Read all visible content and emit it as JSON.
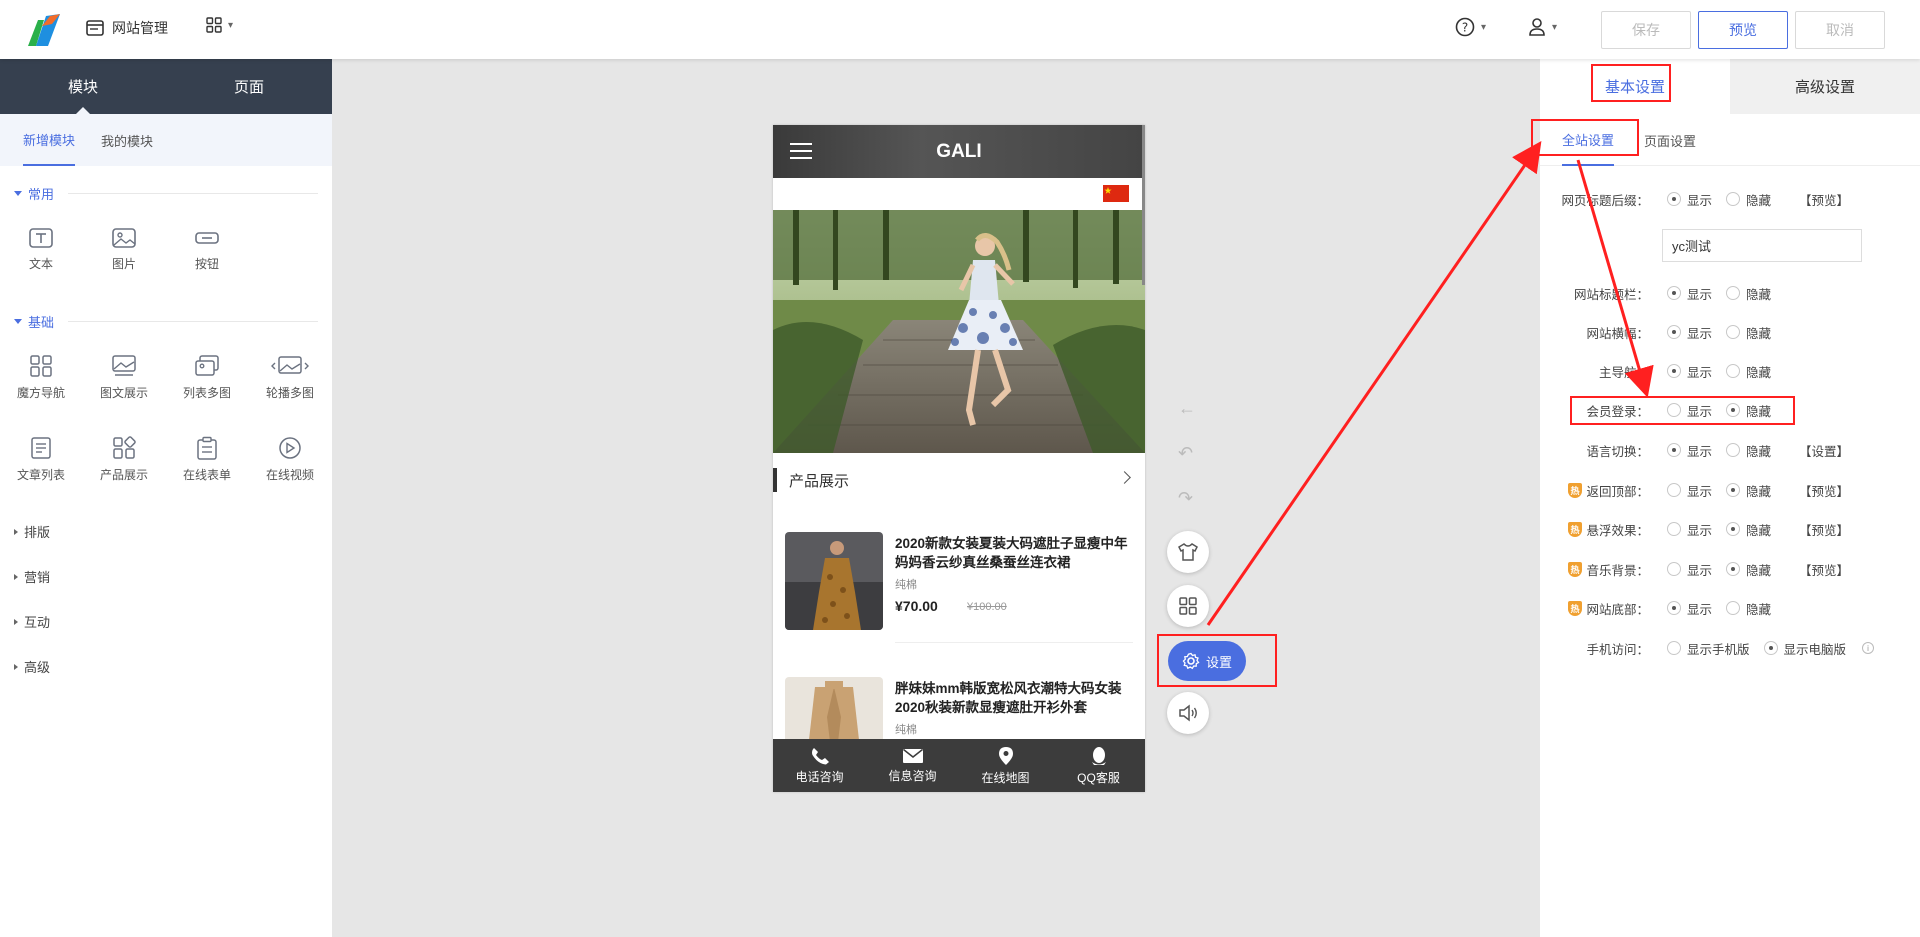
{
  "topbar": {
    "site_manage": "网站管理",
    "save": "保存",
    "preview": "预览",
    "cancel": "取消"
  },
  "left": {
    "tabs": [
      "模块",
      "页面"
    ],
    "subtabs": [
      "新增模块",
      "我的模块"
    ],
    "categories": {
      "common": "常用",
      "basic": "基础",
      "layout": "排版",
      "marketing": "营销",
      "interact": "互动",
      "advanced": "高级"
    },
    "common_modules": [
      "文本",
      "图片",
      "按钮"
    ],
    "basic_modules": [
      "魔方导航",
      "图文展示",
      "列表多图",
      "轮播多图",
      "文章列表",
      "产品展示",
      "在线表单",
      "在线视频"
    ]
  },
  "phone": {
    "title": "GALI",
    "section": "产品展示",
    "products": [
      {
        "name": "2020新款女装夏装大码遮肚子显瘦中年妈妈香云纱真丝桑蚕丝连衣裙",
        "material": "纯棉",
        "price": "¥70.00",
        "old_price": "¥100.00"
      },
      {
        "name": "胖妹妹mm韩版宽松风衣潮特大码女装2020秋装新款显瘦遮肚开衫外套",
        "material": "纯棉"
      }
    ],
    "footer": [
      "电话咨询",
      "信息咨询",
      "在线地图",
      "QQ客服"
    ]
  },
  "tools": {
    "settings": "设置"
  },
  "right": {
    "tabs": [
      "基本设置",
      "高级设置"
    ],
    "subtabs": [
      "全站设置",
      "页面设置"
    ],
    "input_value": "yc测试",
    "hot_badge": "热",
    "rows": [
      {
        "label": "网页标题后缀：",
        "opt1": "显示",
        "opt2": "隐藏",
        "selected": 1,
        "link": "【预览】"
      },
      {
        "label": "网站标题栏：",
        "opt1": "显示",
        "opt2": "隐藏",
        "selected": 1
      },
      {
        "label": "网站横幅：",
        "opt1": "显示",
        "opt2": "隐藏",
        "selected": 1
      },
      {
        "label": "主导航：",
        "opt1": "显示",
        "opt2": "隐藏",
        "selected": 1
      },
      {
        "label": "会员登录：",
        "opt1": "显示",
        "opt2": "隐藏",
        "selected": 2
      },
      {
        "label": "语言切换：",
        "opt1": "显示",
        "opt2": "隐藏",
        "selected": 1,
        "link": "【设置】"
      },
      {
        "label": "返回顶部：",
        "opt1": "显示",
        "opt2": "隐藏",
        "selected": 2,
        "link": "【预览】",
        "hot": true
      },
      {
        "label": "悬浮效果：",
        "opt1": "显示",
        "opt2": "隐藏",
        "selected": 2,
        "link": "【预览】",
        "hot": true
      },
      {
        "label": "音乐背景：",
        "opt1": "显示",
        "opt2": "隐藏",
        "selected": 2,
        "link": "【预览】",
        "hot": true
      },
      {
        "label": "网站底部：",
        "opt1": "显示",
        "opt2": "隐藏",
        "selected": 1,
        "hot": true
      },
      {
        "label": "手机访问：",
        "opt1": "显示手机版",
        "opt2": "显示电脑版",
        "selected": 2,
        "info": "i"
      }
    ]
  },
  "colors": {
    "accent": "#4a6ee0",
    "annotation": "#ff2020",
    "dark_header": "#36404f"
  }
}
